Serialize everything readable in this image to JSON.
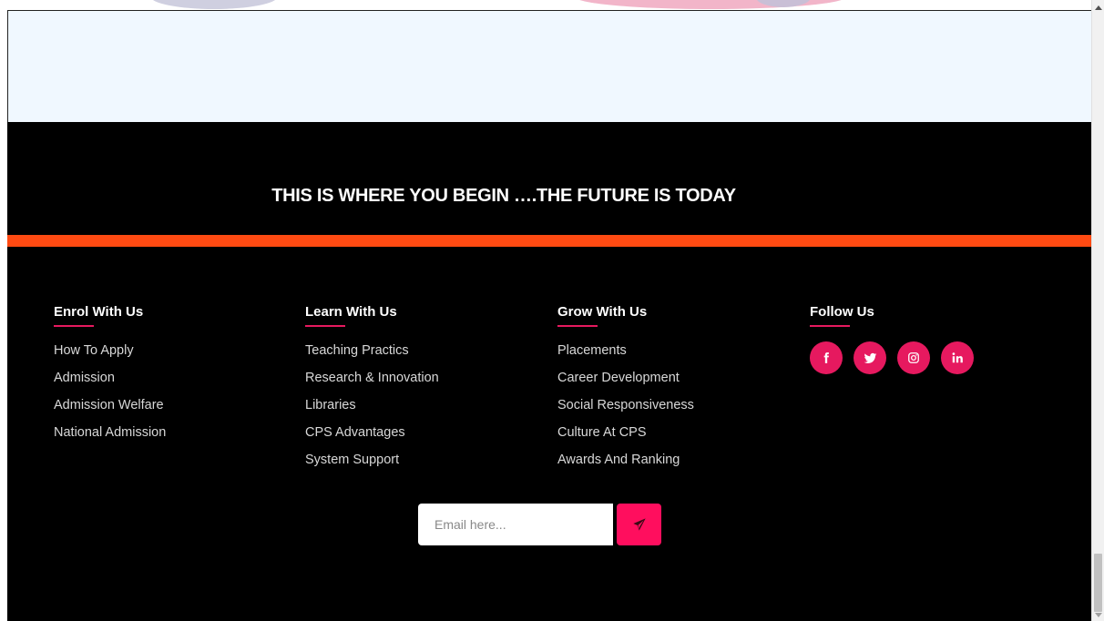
{
  "tagline": "THIS IS WHERE YOU BEGIN ….THE FUTURE IS TODAY",
  "columns": {
    "enrol": {
      "heading": "Enrol With Us",
      "links": [
        "How To Apply",
        "Admission",
        "Admission Welfare",
        "National Admission"
      ]
    },
    "learn": {
      "heading": "Learn With Us",
      "links": [
        "Teaching Practics",
        "Research & Innovation",
        "Libraries",
        "CPS Advantages",
        "System Support"
      ]
    },
    "grow": {
      "heading": "Grow With Us",
      "links": [
        "Placements",
        "Career Development",
        "Social Responsiveness",
        "Culture At CPS",
        "Awards And Ranking"
      ]
    },
    "follow": {
      "heading": "Follow Us",
      "icons": [
        "facebook-icon",
        "twitter-icon",
        "instagram-icon",
        "linkedin-icon"
      ]
    }
  },
  "subscribe": {
    "placeholder": "Email here...",
    "value": ""
  },
  "colors": {
    "footer_bg": "#000000",
    "accent_orange": "#ff4a12",
    "accent_pink": "#e6195f",
    "button_pink": "#ff0e5e",
    "light_section_bg": "#f0f8ff"
  }
}
